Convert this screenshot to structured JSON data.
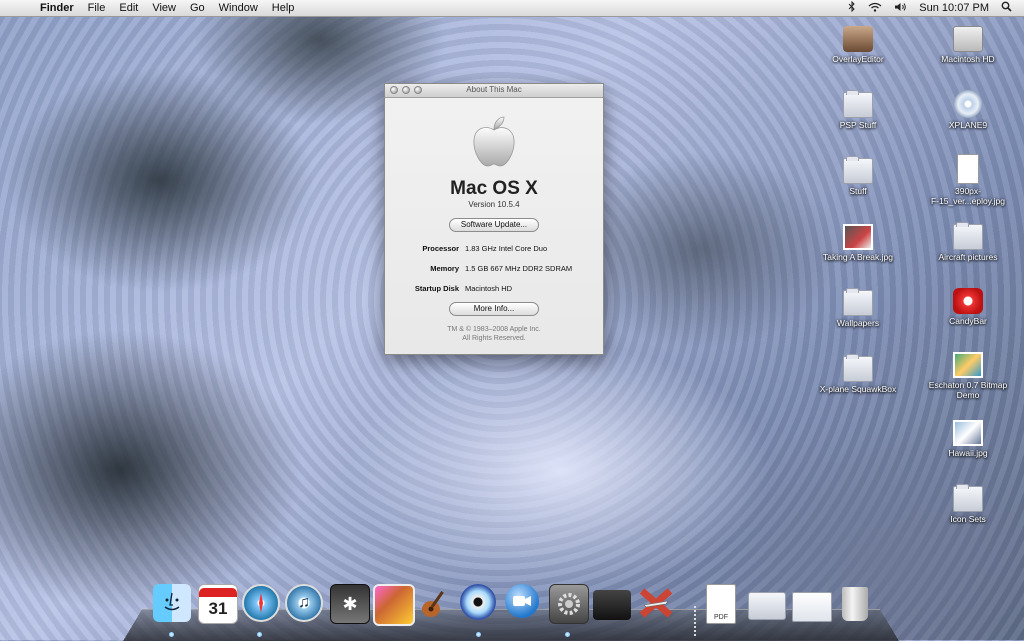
{
  "menubar": {
    "app": "Finder",
    "menus": [
      "File",
      "Edit",
      "View",
      "Go",
      "Window",
      "Help"
    ],
    "clock": "Sun 10:07 PM",
    "icons": [
      "apple-icon",
      "bluetooth-icon",
      "wifi-icon",
      "volume-icon",
      "spotlight-icon"
    ]
  },
  "about": {
    "title": "About This Mac",
    "os_name": "Mac OS X",
    "version": "Version 10.5.4",
    "software_update": "Software Update...",
    "processor_label": "Processor",
    "processor_value": "1.83 GHz Intel Core Duo",
    "memory_label": "Memory",
    "memory_value": "1.5 GB 667 MHz DDR2 SDRAM",
    "startup_label": "Startup Disk",
    "startup_value": "Macintosh HD",
    "more_info": "More Info...",
    "copyright1": "TM & © 1983–2008 Apple Inc.",
    "copyright2": "All Rights Reserved."
  },
  "desktop_icons": [
    {
      "label": "OverlayEditor",
      "icon": "app-icon"
    },
    {
      "label": "Macintosh HD",
      "icon": "hard-drive-icon"
    },
    {
      "label": "PSP Stuff",
      "icon": "folder-icon"
    },
    {
      "label": "XPLANE9",
      "icon": "dvd-icon"
    },
    {
      "label": "Stuff",
      "icon": "folder-icon"
    },
    {
      "label": "390px-",
      "label2": "F-15_ver...eploy.jpg",
      "icon": "image-file-icon"
    },
    {
      "label": "Taking A Break.jpg",
      "icon": "image-file-icon"
    },
    {
      "label": "Aircraft pictures",
      "icon": "folder-icon"
    },
    {
      "label": "Wallpapers",
      "icon": "folder-icon"
    },
    {
      "label": "CandyBar",
      "icon": "app-icon"
    },
    {
      "label": "X-plane SquawkBox",
      "icon": "folder-icon"
    },
    {
      "label": "Eschaton 0.7 Bitmap",
      "label2": "Demo",
      "icon": "app-icon"
    },
    {
      "label": "Hawaii.jpg",
      "icon": "image-file-icon"
    },
    {
      "label": "Icon Sets",
      "icon": "folder-icon"
    }
  ],
  "dock": {
    "items": [
      {
        "name": "finder-icon"
      },
      {
        "name": "ical-icon",
        "text": "31"
      },
      {
        "name": "safari-icon"
      },
      {
        "name": "itunes-icon"
      },
      {
        "name": "imovie-icon"
      },
      {
        "name": "iphoto-icon"
      },
      {
        "name": "garageband-icon"
      },
      {
        "name": "dvd-player-icon"
      },
      {
        "name": "ichat-icon"
      },
      {
        "name": "system-preferences-icon"
      },
      {
        "name": "game-console-icon"
      },
      {
        "name": "x-plane-icon"
      },
      {
        "name": "pdf-document-icon"
      },
      {
        "name": "downloads-stack-icon"
      },
      {
        "name": "documents-stack-icon"
      },
      {
        "name": "trash-icon"
      }
    ]
  }
}
